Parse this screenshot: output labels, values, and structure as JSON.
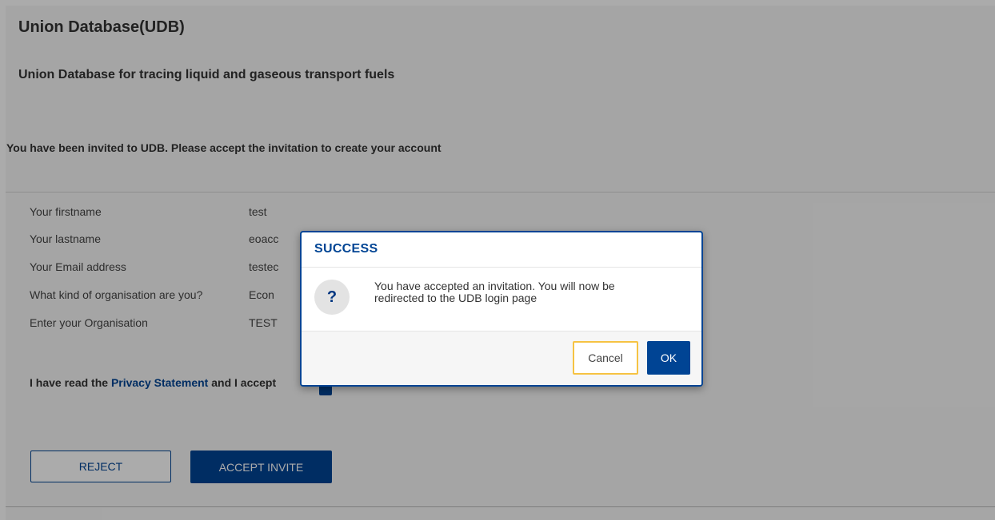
{
  "app": {
    "title": "Union Database(UDB)",
    "subtitle": "Union Database for tracing liquid and gaseous transport fuels",
    "invite_message": "You have been invited to UDB. Please accept the invitation to create your account"
  },
  "form": {
    "fields": [
      {
        "label": "Your firstname",
        "value": "test"
      },
      {
        "label": "Your lastname",
        "value": "eoacc"
      },
      {
        "label": "Your Email address",
        "value": "testec"
      },
      {
        "label": "What kind of organisation are you?",
        "value": "Econ"
      },
      {
        "label": "Enter your Organisation",
        "value": "TEST"
      }
    ],
    "privacy_prefix": "I have read the ",
    "privacy_link": "Privacy Statement",
    "privacy_suffix": " and I accept",
    "privacy_checked": true,
    "reject_label": "REJECT",
    "accept_label": "ACCEPT INVITE"
  },
  "dialog": {
    "title": "SUCCESS",
    "icon": "question-icon",
    "icon_glyph": "?",
    "message": "You have accepted an invitation. You will now be redirected to the UDB login page",
    "cancel_label": "Cancel",
    "ok_label": "OK"
  },
  "colors": {
    "primary": "#004494",
    "focus_outline": "#f6c343"
  }
}
